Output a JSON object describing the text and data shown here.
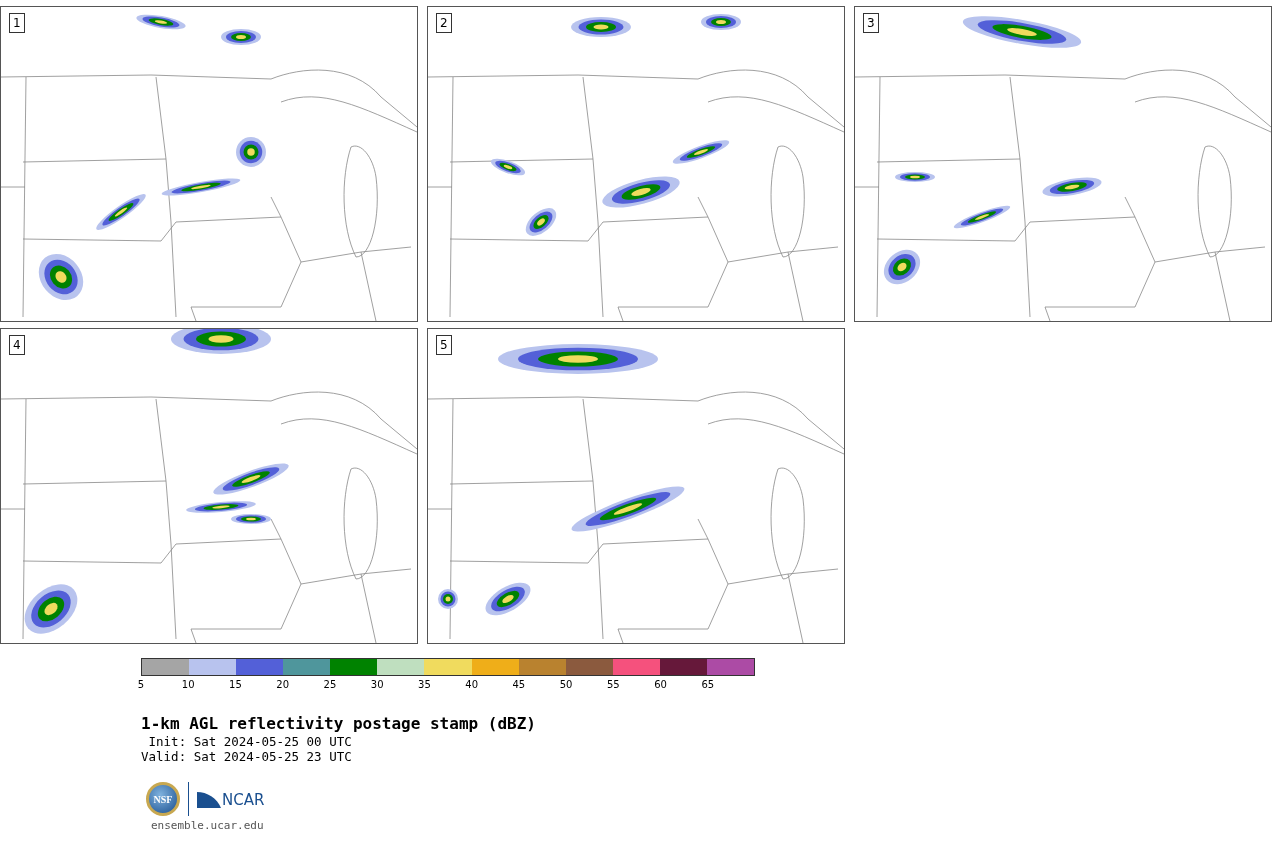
{
  "panels": [
    {
      "label": "1"
    },
    {
      "label": "2"
    },
    {
      "label": "3"
    },
    {
      "label": "4"
    },
    {
      "label": "5"
    }
  ],
  "colorbar": {
    "bins": [
      {
        "color": "#a5a5a5",
        "tick": "5"
      },
      {
        "color": "#b8c3ee",
        "tick": "10"
      },
      {
        "color": "#5360d8",
        "tick": "15"
      },
      {
        "color": "#4f969c",
        "tick": "20"
      },
      {
        "color": "#008200",
        "tick": "25"
      },
      {
        "color": "#bfdfbf",
        "tick": "30"
      },
      {
        "color": "#f0db5e",
        "tick": "35"
      },
      {
        "color": "#efae19",
        "tick": "40"
      },
      {
        "color": "#b9822f",
        "tick": "45"
      },
      {
        "color": "#8b5a3e",
        "tick": "50"
      },
      {
        "color": "#f5517d",
        "tick": "55"
      },
      {
        "color": "#66183a",
        "tick": "60"
      },
      {
        "color": "#ac4ba5",
        "tick": "65"
      }
    ]
  },
  "title": "1-km AGL reflectivity postage stamp (dBZ)",
  "init": " Init: Sat 2024-05-25 00 UTC",
  "valid": "Valid: Sat 2024-05-25 23 UTC",
  "logo": {
    "nsf": "NSF",
    "ncar": "NCAR"
  },
  "url": "ensemble.ucar.edu"
}
